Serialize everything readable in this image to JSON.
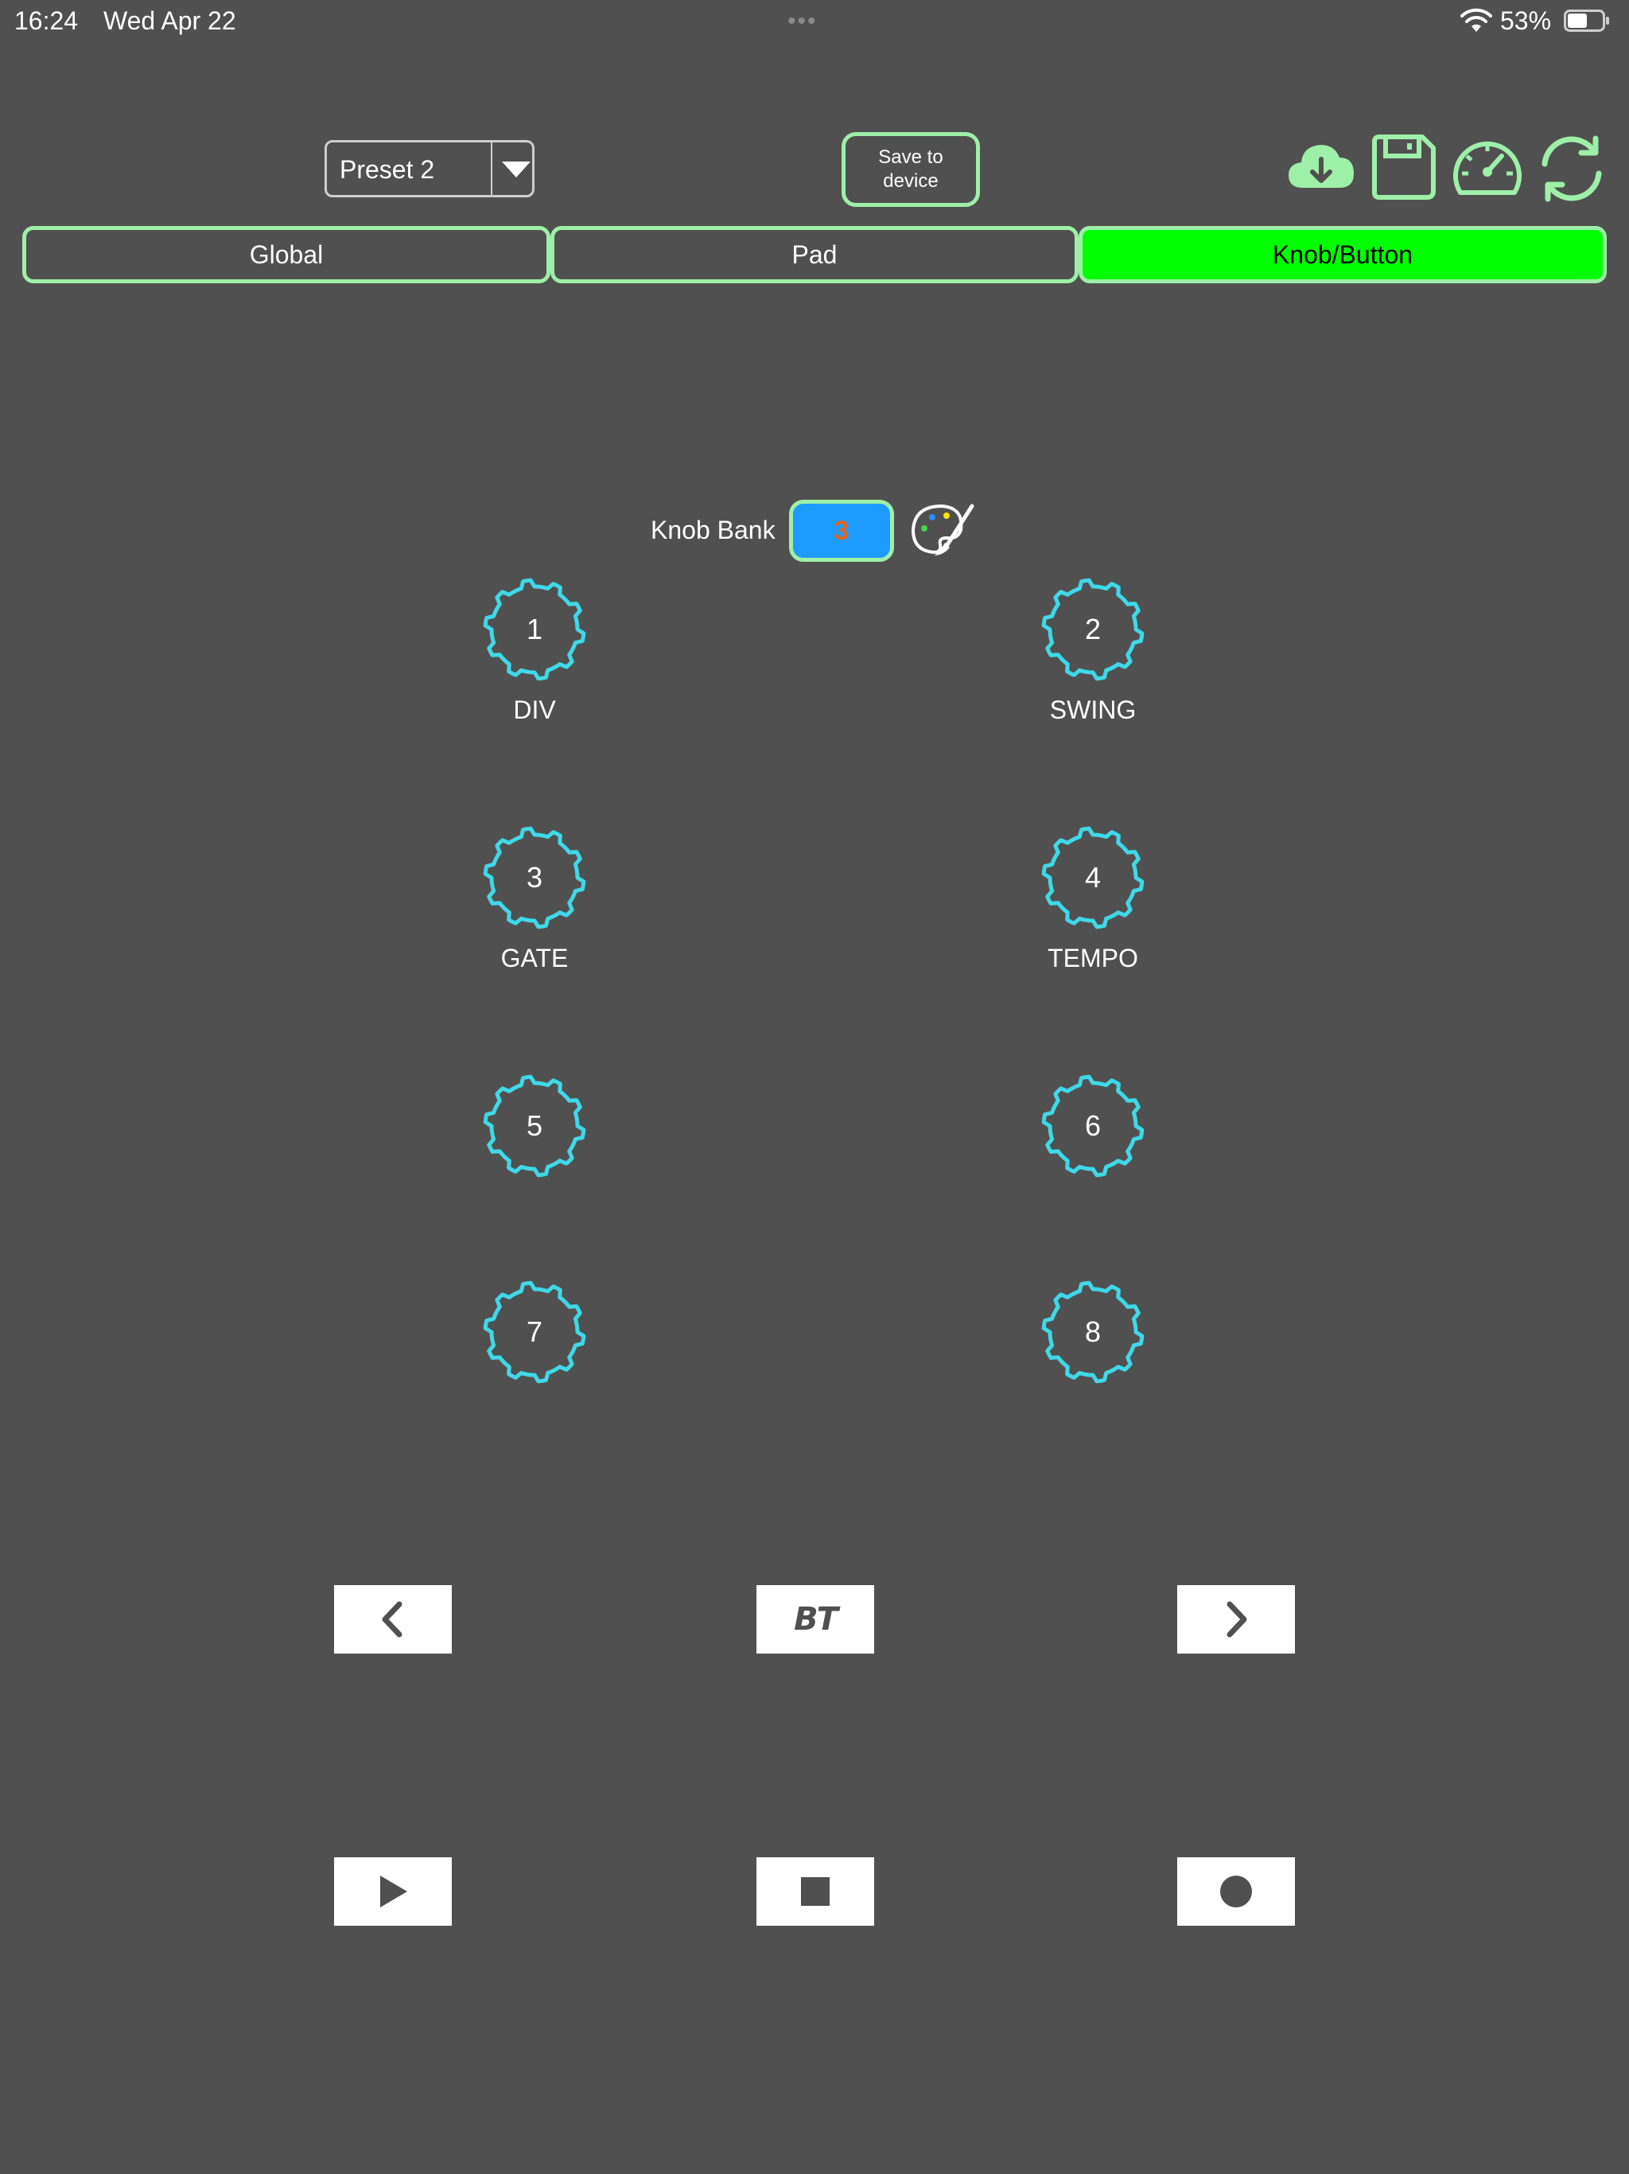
{
  "status_bar": {
    "time": "16:24",
    "date": "Wed Apr 22",
    "battery": "53%",
    "dots": "•••"
  },
  "toolbar": {
    "preset_selected": "Preset 2",
    "save_to_device": "Save to\ndevice",
    "icons": [
      "cloud-download-icon",
      "save-icon",
      "gauge-icon",
      "refresh-icon"
    ]
  },
  "tabs": [
    {
      "label": "Global",
      "active": false
    },
    {
      "label": "Pad",
      "active": false
    },
    {
      "label": "Knob/Button",
      "active": true
    }
  ],
  "knob_bank": {
    "label": "Knob Bank",
    "value": "3"
  },
  "knobs": [
    {
      "number": "1",
      "label": "DIV"
    },
    {
      "number": "2",
      "label": "SWING"
    },
    {
      "number": "3",
      "label": "GATE"
    },
    {
      "number": "4",
      "label": "TEMPO"
    },
    {
      "number": "5",
      "label": ""
    },
    {
      "number": "6",
      "label": ""
    },
    {
      "number": "7",
      "label": ""
    },
    {
      "number": "8",
      "label": ""
    }
  ],
  "transport": {
    "bt_label": "BT",
    "buttons": [
      "previous",
      "bt",
      "next",
      "play",
      "stop",
      "record"
    ]
  },
  "colors": {
    "background": "#505050",
    "accent_green": "#9ef0a8",
    "active_tab": "#00ff00",
    "knob_cyan": "#3fd8e8",
    "bank_blue": "#1e9bff",
    "bank_value_orange": "#e0641e"
  }
}
